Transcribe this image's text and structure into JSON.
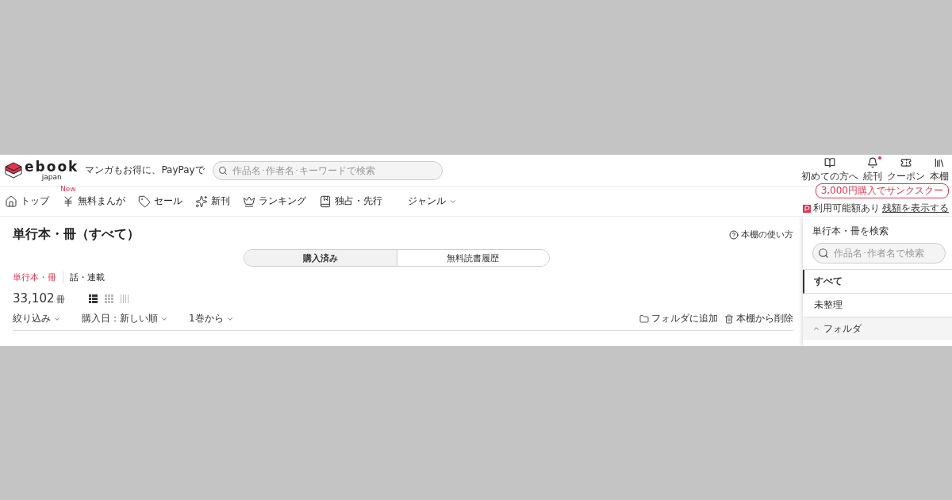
{
  "header": {
    "logo": {
      "name": "ebook",
      "sub": "japan"
    },
    "tagline": "マンガもお得に、PayPayで",
    "search": {
      "placeholder": "作品名･作者名･キーワードで検索"
    },
    "icons": [
      {
        "kind": "book",
        "label": "初めての方へ",
        "badge": false
      },
      {
        "kind": "bell",
        "label": "続刊",
        "badge": true
      },
      {
        "kind": "coupon",
        "label": "クーポン",
        "badge": false
      },
      {
        "kind": "shelf",
        "label": "本棚",
        "badge": false
      }
    ],
    "promo": "3,000円購入でサンクスクー",
    "paypay": {
      "status": "利用可能額あり",
      "link": "残額を表示する"
    }
  },
  "nav": [
    {
      "kind": "home",
      "label": "トップ"
    },
    {
      "kind": "free",
      "label": "無料まんが",
      "badge": "New"
    },
    {
      "kind": "sale",
      "label": "セール"
    },
    {
      "kind": "new",
      "label": "新刊"
    },
    {
      "kind": "crown",
      "label": "ランキング"
    },
    {
      "kind": "exclusive",
      "label": "独占・先行"
    },
    {
      "kind": "menu",
      "label": "ジャンル"
    }
  ],
  "page": {
    "title": "単行本・冊（すべて）",
    "help": "本棚の使い方",
    "tabs": [
      {
        "label": "購入済み",
        "selected": true
      },
      {
        "label": "無料読書履歴",
        "selected": false
      }
    ],
    "subtabs": [
      {
        "label": "単行本・冊",
        "selected": true
      },
      {
        "label": "話・連載",
        "selected": false
      }
    ],
    "count": {
      "number": "33,102",
      "unit": "冊"
    },
    "views": [
      {
        "kind": "list",
        "selected": true
      },
      {
        "kind": "grid",
        "selected": false
      },
      {
        "kind": "spine",
        "selected": false
      }
    ],
    "filters": [
      {
        "label": "絞り込み"
      },
      {
        "label": "購入日：新しい順"
      },
      {
        "label": "1巻から"
      }
    ],
    "actions": [
      {
        "kind": "folder",
        "label": "フォルダに追加"
      },
      {
        "kind": "trash",
        "label": "本棚から削除"
      }
    ]
  },
  "sidebar": {
    "search_label": "単行本・冊を検索",
    "search": {
      "placeholder": "作品名･作者名で検索"
    },
    "items": [
      {
        "label": "すべて",
        "selected": true
      },
      {
        "label": "未整理",
        "selected": false
      }
    ],
    "folder": {
      "label": "フォルダ",
      "expanded": true
    }
  }
}
